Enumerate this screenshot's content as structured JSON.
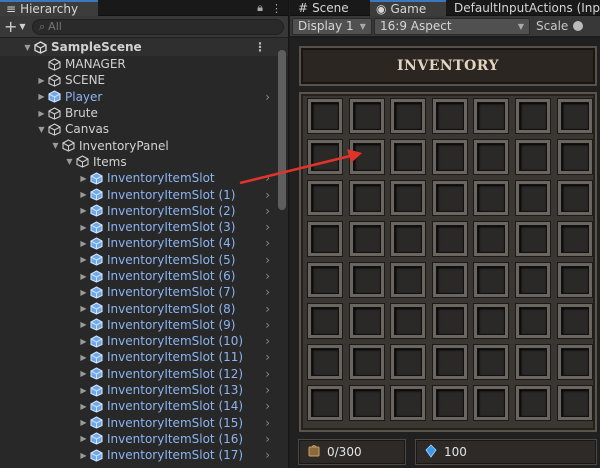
{
  "hierarchy": {
    "tab_label": "Hierarchy",
    "search_placeholder": "All",
    "scene_name": "SampleScene",
    "items": [
      {
        "label": "MANAGER",
        "indent": 1,
        "expand": "none",
        "prefab": false
      },
      {
        "label": "SCENE",
        "indent": 1,
        "expand": "collapsed",
        "prefab": false
      },
      {
        "label": "Player",
        "indent": 1,
        "expand": "collapsed",
        "prefab": true,
        "has_child_arrow": true
      },
      {
        "label": "Brute",
        "indent": 1,
        "expand": "collapsed",
        "prefab": false
      },
      {
        "label": "Canvas",
        "indent": 1,
        "expand": "expanded",
        "prefab": false
      },
      {
        "label": "InventoryPanel",
        "indent": 2,
        "expand": "expanded",
        "prefab": false
      },
      {
        "label": "Items",
        "indent": 3,
        "expand": "expanded",
        "prefab": false
      },
      {
        "label": "InventoryItemSlot",
        "indent": 4,
        "expand": "collapsed",
        "prefab": true,
        "has_child_arrow": true
      },
      {
        "label": "InventoryItemSlot (1)",
        "indent": 4,
        "expand": "collapsed",
        "prefab": true,
        "has_child_arrow": true
      },
      {
        "label": "InventoryItemSlot (2)",
        "indent": 4,
        "expand": "collapsed",
        "prefab": true,
        "has_child_arrow": true
      },
      {
        "label": "InventoryItemSlot (3)",
        "indent": 4,
        "expand": "collapsed",
        "prefab": true,
        "has_child_arrow": true
      },
      {
        "label": "InventoryItemSlot (4)",
        "indent": 4,
        "expand": "collapsed",
        "prefab": true,
        "has_child_arrow": true
      },
      {
        "label": "InventoryItemSlot (5)",
        "indent": 4,
        "expand": "collapsed",
        "prefab": true,
        "has_child_arrow": true
      },
      {
        "label": "InventoryItemSlot (6)",
        "indent": 4,
        "expand": "collapsed",
        "prefab": true,
        "has_child_arrow": true
      },
      {
        "label": "InventoryItemSlot (7)",
        "indent": 4,
        "expand": "collapsed",
        "prefab": true,
        "has_child_arrow": true
      },
      {
        "label": "InventoryItemSlot (8)",
        "indent": 4,
        "expand": "collapsed",
        "prefab": true,
        "has_child_arrow": true
      },
      {
        "label": "InventoryItemSlot (9)",
        "indent": 4,
        "expand": "collapsed",
        "prefab": true,
        "has_child_arrow": true
      },
      {
        "label": "InventoryItemSlot (10)",
        "indent": 4,
        "expand": "collapsed",
        "prefab": true,
        "has_child_arrow": true
      },
      {
        "label": "InventoryItemSlot (11)",
        "indent": 4,
        "expand": "collapsed",
        "prefab": true,
        "has_child_arrow": true
      },
      {
        "label": "InventoryItemSlot (12)",
        "indent": 4,
        "expand": "collapsed",
        "prefab": true,
        "has_child_arrow": true
      },
      {
        "label": "InventoryItemSlot (13)",
        "indent": 4,
        "expand": "collapsed",
        "prefab": true,
        "has_child_arrow": true
      },
      {
        "label": "InventoryItemSlot (14)",
        "indent": 4,
        "expand": "collapsed",
        "prefab": true,
        "has_child_arrow": true
      },
      {
        "label": "InventoryItemSlot (15)",
        "indent": 4,
        "expand": "collapsed",
        "prefab": true,
        "has_child_arrow": true
      },
      {
        "label": "InventoryItemSlot (16)",
        "indent": 4,
        "expand": "collapsed",
        "prefab": true,
        "has_child_arrow": true
      },
      {
        "label": "InventoryItemSlot (17)",
        "indent": 4,
        "expand": "collapsed",
        "prefab": true,
        "has_child_arrow": true
      }
    ]
  },
  "game_view": {
    "tabs": [
      {
        "label": "Scene",
        "icon": "grid-icon"
      },
      {
        "label": "Game",
        "icon": "gamepad-icon"
      },
      {
        "label": "DefaultInputActions (Inpu",
        "icon": "input-actions-icon"
      }
    ],
    "active_tab": "Game",
    "display_label": "Display 1",
    "aspect_label": "16:9 Aspect",
    "scale_label": "Scale"
  },
  "inventory": {
    "title": "INVENTORY",
    "columns": 7,
    "rows": 8,
    "weight_text": "0/300",
    "gems_text": "100"
  },
  "colors": {
    "prefab_text": "#8cb4ef",
    "annotation_arrow": "#e0342a",
    "prefab_icon": "#6fa8e6"
  }
}
